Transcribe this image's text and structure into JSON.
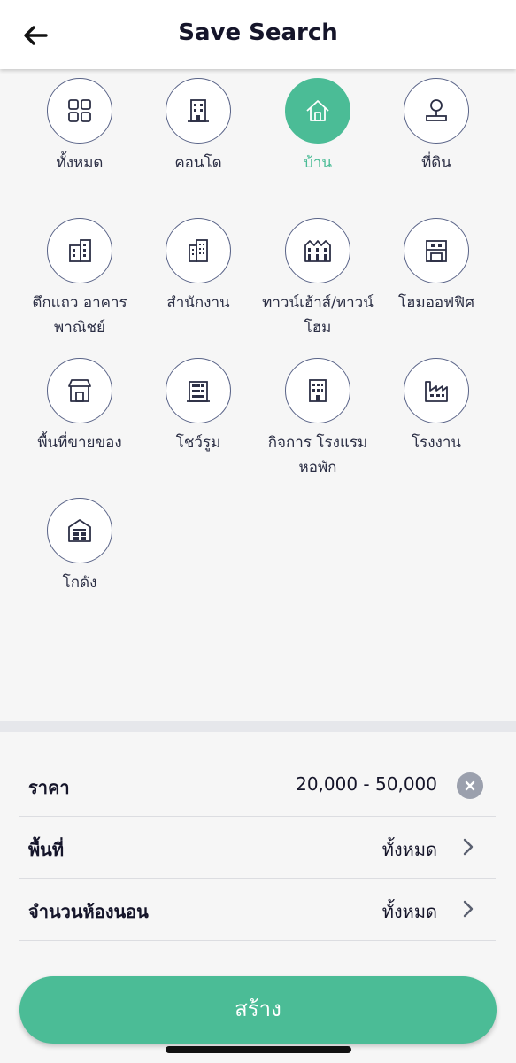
{
  "header": {
    "title": "Save Search",
    "back_icon": "arrow-left-icon"
  },
  "categories": [
    {
      "label": "ทั้งหมด",
      "icon": "grid-icon",
      "active": false
    },
    {
      "label": "คอนโด",
      "icon": "building-icon",
      "active": false
    },
    {
      "label": "บ้าน",
      "icon": "house-icon",
      "active": true
    },
    {
      "label": "ที่ดิน",
      "icon": "land-icon",
      "active": false
    },
    {
      "label": "ตึกแถว อาคารพาณิชย์",
      "icon": "shophouse-icon",
      "active": false
    },
    {
      "label": "สำนักงาน",
      "icon": "office-icon",
      "active": false
    },
    {
      "label": "ทาวน์เฮ้าส์/ทาวน์โฮม",
      "icon": "townhouse-icon",
      "active": false
    },
    {
      "label": "โฮมออฟฟิศ",
      "icon": "home-office-icon",
      "active": false
    },
    {
      "label": "พื้นที่ขายของ",
      "icon": "store-icon",
      "active": false
    },
    {
      "label": "โชว์รูม",
      "icon": "showroom-icon",
      "active": false
    },
    {
      "label": "กิจการ โรงแรม หอพัก",
      "icon": "hotel-icon",
      "active": false
    },
    {
      "label": "โรงงาน",
      "icon": "factory-icon",
      "active": false
    },
    {
      "label": "โกดัง",
      "icon": "warehouse-icon",
      "active": false
    }
  ],
  "filters": {
    "price": {
      "label": "ราคา",
      "value": "20,000 - 50,000"
    },
    "area": {
      "label": "พื้นที่",
      "value": "ทั้งหมด"
    },
    "bedrooms": {
      "label": "จำนวนห้องนอน",
      "value": "ทั้งหมด"
    }
  },
  "create_button": {
    "label": "สร้าง"
  },
  "colors": {
    "accent": "#4bbc96",
    "icon_stroke": "#2c2f45"
  }
}
